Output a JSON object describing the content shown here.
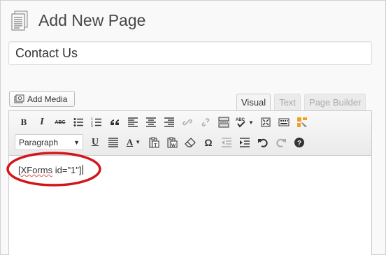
{
  "header": {
    "title": "Add New Page",
    "icon": "pages-icon"
  },
  "title_field": {
    "value": "Contact Us"
  },
  "media": {
    "add_media_label": "Add Media"
  },
  "editor_tabs": [
    {
      "label": "Visual",
      "active": true
    },
    {
      "label": "Text",
      "active": false
    },
    {
      "label": "Page Builder",
      "active": false
    }
  ],
  "toolbar": {
    "format_select_value": "Paragraph",
    "row1_icons": [
      "bold-icon",
      "italic-icon",
      "strikethrough-icon",
      "bullet-list-icon",
      "numbered-list-icon",
      "blockquote-icon",
      "align-left-icon",
      "align-center-icon",
      "align-right-icon",
      "link-icon",
      "unlink-icon",
      "insert-more-icon",
      "spellcheck-icon",
      "fullscreen-icon",
      "kitchen-sink-icon",
      "page-builder-icon"
    ],
    "row2_icons": [
      "underline-icon",
      "justify-icon",
      "text-color-icon",
      "paste-as-text-icon",
      "paste-from-word-icon",
      "clear-formatting-icon",
      "special-character-icon",
      "outdent-icon",
      "indent-icon",
      "undo-icon",
      "redo-icon",
      "help-icon"
    ],
    "bold_label": "B",
    "italic_label": "I",
    "strike_label": "ABC",
    "underline_label": "U",
    "color_label": "A",
    "omega_label": "Ω",
    "spell_label": "ABC"
  },
  "content": {
    "shortcode_open": "[",
    "shortcode_word": "XForms",
    "shortcode_rest": " id=\"1\"]"
  },
  "colors": {
    "highlight": "#d3151a",
    "text": "#333333",
    "misspell": "#e05050"
  }
}
